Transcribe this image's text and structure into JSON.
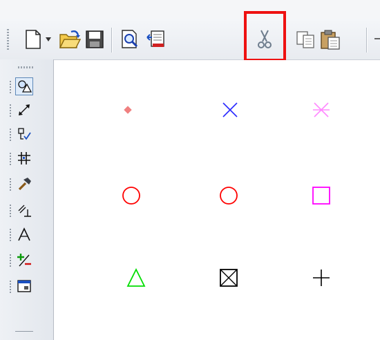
{
  "toolbar": {
    "buttons": [
      {
        "name": "new-document",
        "icon": "document-icon"
      },
      {
        "name": "dropdown",
        "icon": "chevron-down-icon"
      },
      {
        "name": "open-folder",
        "icon": "folder-open-icon"
      },
      {
        "name": "save",
        "icon": "floppy-disk-icon"
      },
      {
        "name": "print-preview",
        "icon": "magnifier-document-icon"
      },
      {
        "name": "page-setup",
        "icon": "page-setup-icon"
      },
      {
        "name": "cut",
        "icon": "scissors-icon",
        "highlighted": true
      },
      {
        "name": "copy",
        "icon": "copy-icon"
      },
      {
        "name": "paste",
        "icon": "clipboard-paste-icon"
      }
    ],
    "highlight_color": "#ee1111"
  },
  "sidebar": {
    "tools": [
      {
        "name": "shape-select",
        "icon": "shapes-icon",
        "active": true
      },
      {
        "name": "measure",
        "icon": "dimension-arrow-icon"
      },
      {
        "name": "point-tool",
        "icon": "point-checkmark-icon"
      },
      {
        "name": "grid",
        "icon": "grid-icon"
      },
      {
        "name": "hammer",
        "icon": "hammer-icon"
      },
      {
        "name": "perpendicular",
        "icon": "perpendicular-icon"
      },
      {
        "name": "compass",
        "icon": "compass-icon"
      },
      {
        "name": "plus-minus",
        "icon": "plus-minus-icon"
      },
      {
        "name": "window-tool",
        "icon": "window-icon"
      }
    ]
  },
  "canvas": {
    "symbols": [
      {
        "shape": "diamond",
        "color": "#f08080"
      },
      {
        "shape": "x-cross",
        "color": "#2a2aff"
      },
      {
        "shape": "asterisk",
        "color": "#ff88ff"
      },
      {
        "shape": "circle",
        "color": "#ff0000"
      },
      {
        "shape": "circle",
        "color": "#ff0000"
      },
      {
        "shape": "square",
        "color": "#ff00ff"
      },
      {
        "shape": "triangle",
        "color": "#00dd00"
      },
      {
        "shape": "boxed-x",
        "color": "#000000"
      },
      {
        "shape": "plus",
        "color": "#000000"
      }
    ]
  }
}
